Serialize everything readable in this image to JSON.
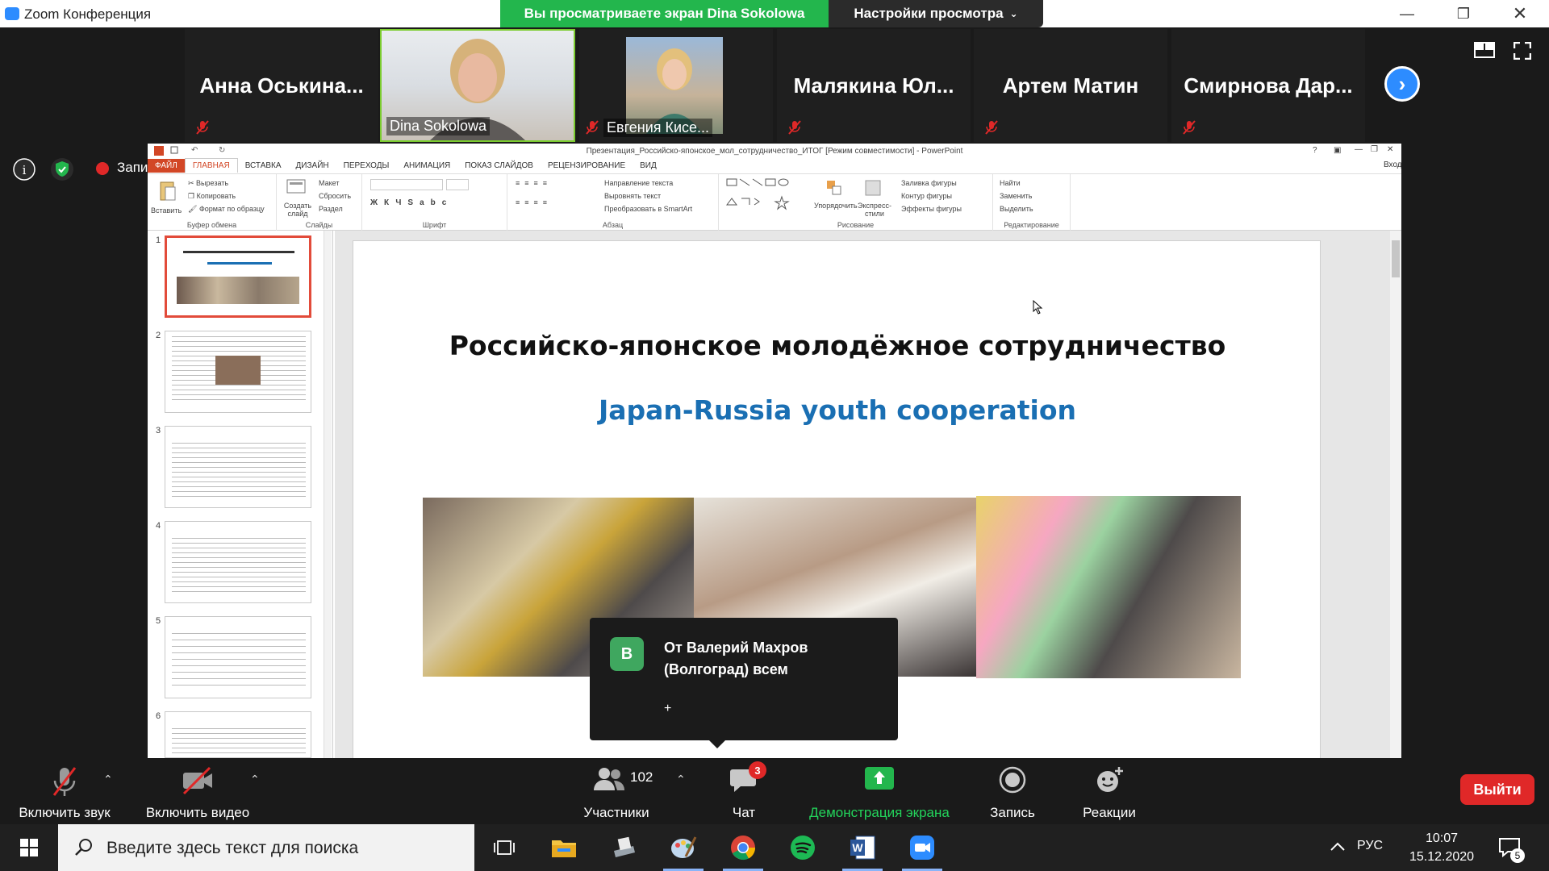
{
  "window": {
    "title": "Zoom Конференция",
    "view_banner": "Вы просматриваете экран Dina Sokolowa",
    "view_settings": "Настройки просмотра"
  },
  "participants": [
    {
      "name": "Анна  Оськина...",
      "video": false
    },
    {
      "name": "Dina Sokolowa",
      "video": true
    },
    {
      "name": "Евгения Кисе...",
      "video": true
    },
    {
      "name": "Малякина  Юл...",
      "video": false
    },
    {
      "name": "Артем Матин",
      "video": false
    },
    {
      "name": "Смирнова  Дар...",
      "video": false
    }
  ],
  "recording_label": "Запись",
  "powerpoint": {
    "title": "Презентация_Российско-японское_мол_сотрудничество_ИТОГ [Режим совместимости] - PowerPoint",
    "signin": "Вход",
    "tabs": [
      "ФАЙЛ",
      "ГЛАВНАЯ",
      "ВСТАВКА",
      "ДИЗАЙН",
      "ПЕРЕХОДЫ",
      "АНИМАЦИЯ",
      "ПОКАЗ СЛАЙДОВ",
      "РЕЦЕНЗИРОВАНИЕ",
      "ВИД"
    ],
    "ribbon": {
      "paste": "Вставить",
      "cut": "Вырезать",
      "copy": "Копировать",
      "format_painter": "Формат по образцу",
      "clipboard": "Буфер обмена",
      "new_slide": "Создать слайд",
      "layout": "Макет",
      "reset": "Сбросить",
      "section": "Раздел",
      "slides": "Слайды",
      "font": "Шрифт",
      "paragraph": "Абзац",
      "text_direction": "Направление текста",
      "align_text": "Выровнять текст",
      "smartart": "Преобразовать в SmartArt",
      "arrange": "Упорядочить",
      "quick_styles": "Экспресс-стили",
      "shape_fill": "Заливка фигуры",
      "shape_outline": "Контур фигуры",
      "shape_effects": "Эффекты фигуры",
      "drawing": "Рисование",
      "find": "Найти",
      "replace": "Заменить",
      "select": "Выделить",
      "editing": "Редактирование"
    },
    "thumbnails": [
      "1",
      "2",
      "3",
      "4",
      "5",
      "6"
    ],
    "slide": {
      "title_ru": "Российско-японское молодёжное сотрудничество",
      "title_en": "Japan-Russia youth cooperation"
    }
  },
  "chat_popup": {
    "avatar_letter": "В",
    "from": "От Валерий Махров (Волгоград) всем",
    "plus": "+"
  },
  "toolbar": {
    "unmute": "Включить звук",
    "start_video": "Включить видео",
    "participants": "Участники",
    "participants_count": "102",
    "chat": "Чат",
    "chat_badge": "3",
    "share": "Демонстрация экрана",
    "record": "Запись",
    "reactions": "Реакции",
    "leave": "Выйти"
  },
  "taskbar": {
    "search_placeholder": "Введите здесь текст для поиска",
    "lang": "РУС",
    "time": "10:07",
    "date": "15.12.2020",
    "notifications": "5"
  },
  "colors": {
    "zoom_blue": "#2d8cff",
    "banner_green": "#23b64d",
    "leave_red": "#e02828",
    "ppt_accent": "#d24726",
    "slide_en_blue": "#1a6fb3"
  }
}
